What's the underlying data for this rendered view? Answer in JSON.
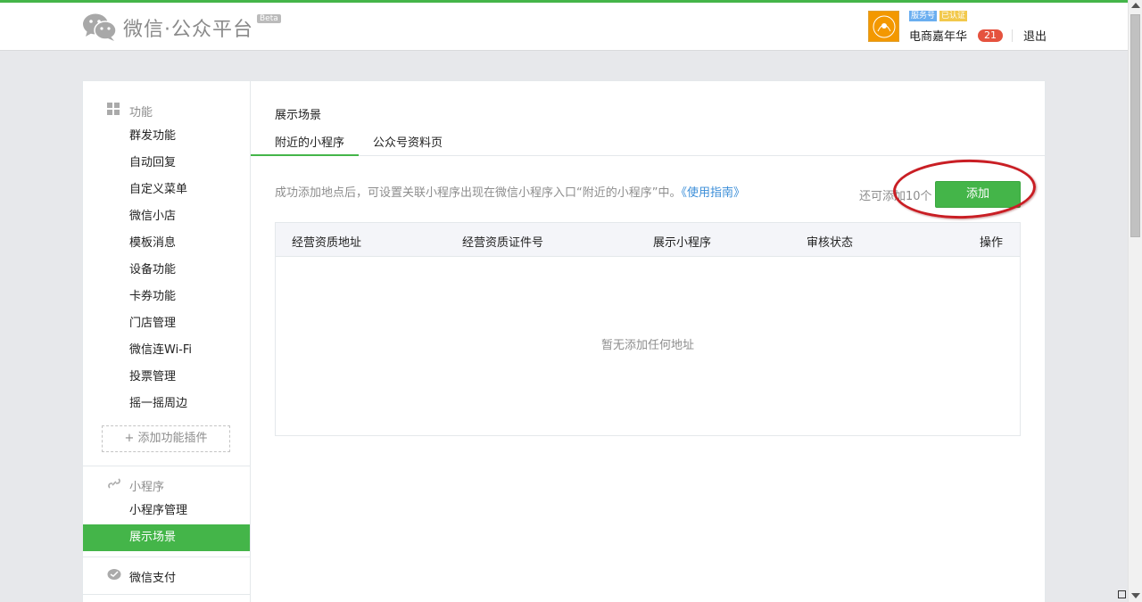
{
  "header": {
    "logo_text": "微信·公众平台",
    "logo_badge": "Beta",
    "account_type": "服务号",
    "verified": "已认证",
    "user_name": "电商嘉年华",
    "message_count": "21",
    "logout": "退出"
  },
  "sidebar": {
    "section_function": "功能",
    "function_items": [
      "群发功能",
      "自动回复",
      "自定义菜单",
      "微信小店",
      "模板消息",
      "设备功能",
      "卡券功能",
      "门店管理",
      "微信连Wi-Fi",
      "投票管理",
      "摇一摇周边"
    ],
    "add_plugin": "+ 添加功能插件",
    "section_miniprogram": "小程序",
    "miniprogram_items": [
      "小程序管理",
      "展示场景"
    ],
    "active_item": "展示场景",
    "section_pay": "微信支付"
  },
  "main": {
    "title": "展示场景",
    "tabs": [
      "附近的小程序",
      "公众号资料页"
    ],
    "active_tab": "附近的小程序",
    "description": "成功添加地点后，可设置关联小程序出现在微信小程序入口“附近的小程序”中。",
    "guide_link": "《使用指南》",
    "remaining": "还可添加10个",
    "add_button": "添加",
    "table": {
      "columns": [
        "经营资质地址",
        "经营资质证件号",
        "展示小程序",
        "审核状态",
        "操作"
      ],
      "empty_text": "暂无添加任何地址"
    }
  },
  "colors": {
    "accent": "#44b549",
    "link": "#3b8ed8",
    "highlight": "#c91e24",
    "badge": "#e5523e"
  },
  "icons": [
    "wechat-logo-icon",
    "grid-icon",
    "link-icon",
    "pay-icon"
  ]
}
